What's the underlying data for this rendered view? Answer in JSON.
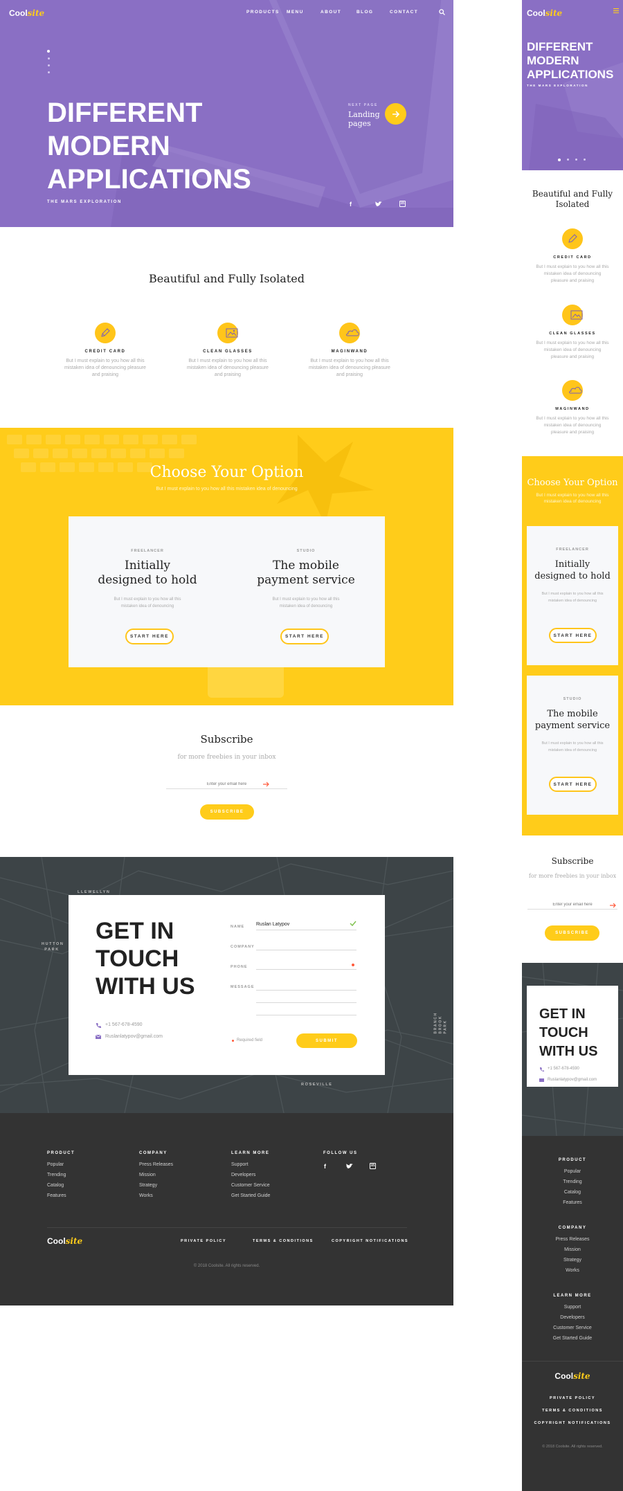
{
  "brand": {
    "cool": "Cool",
    "site": "site"
  },
  "nav": {
    "items": [
      "PRODUCTS",
      "MENU",
      "ABOUT",
      "BLOG",
      "CONTACT"
    ]
  },
  "hero": {
    "title_lines": [
      "DIFFERENT",
      "MODERN",
      "APPLICATIONS"
    ],
    "subtitle": "THE MARS EXPLORATION",
    "next_label": "NEXT PAGE",
    "next_title_lines": [
      "Landing",
      "pages"
    ]
  },
  "features": {
    "heading": "Beautiful and Fully Isolated",
    "items": [
      {
        "icon": "pencil-icon",
        "title": "CREDIT CARD",
        "text": "But I must explain to you how all this mistaken idea of denouncing pleasure and praising"
      },
      {
        "icon": "image-icon",
        "title": "CLEAN GLASSES",
        "text": "But I must explain to you how all this mistaken idea of denouncing pleasure and praising"
      },
      {
        "icon": "cloud-icon",
        "title": "MAGINWAND",
        "text": "But I must explain to you how all this mistaken idea of denouncing pleasure and praising"
      }
    ]
  },
  "options": {
    "heading": "Choose Your Option",
    "sub": "But I must explain to you how all this mistaken idea of denouncing",
    "cards": [
      {
        "label": "FREELANCER",
        "title_lines": [
          "Initially",
          "designed to hold"
        ],
        "text_lines": [
          "But I must explain to you how all this",
          "mistaken idea of denouncing"
        ],
        "button": "START HERE"
      },
      {
        "label": "STUDIO",
        "title_lines": [
          "The mobile",
          "payment service"
        ],
        "text_lines": [
          "But I must explain to you how all this",
          "mistaken idea of denouncing"
        ],
        "button": "START HERE"
      }
    ]
  },
  "subscribe": {
    "heading": "Subscribe",
    "sub": "for more freebies in your inbox",
    "placeholder": "Enter your email here",
    "button": "SUBSCRIBE"
  },
  "contact": {
    "title_lines": [
      "GET IN",
      "TOUCH",
      "WITH US"
    ],
    "phone": "+1 567-678-4590",
    "email": "Ruslanlatypov@gmail.com",
    "fields": {
      "name_label": "NAME",
      "name_value": "Ruslan Latypov",
      "company_label": "COMPANY",
      "phone_label": "PHONE",
      "message_label": "MESSAGE"
    },
    "required": "Required field",
    "submit": "SUBMIT",
    "map_labels": [
      "LLEWELLYN",
      "HUTTON PARK",
      "ROSEVILLE",
      "BRANCH BROOK PARK"
    ]
  },
  "footer": {
    "columns": [
      {
        "title": "PRODUCT",
        "links": [
          "Popular",
          "Trending",
          "Catalog",
          "Features"
        ]
      },
      {
        "title": "COMPANY",
        "links": [
          "Press Releases",
          "Mission",
          "Strategy",
          "Works"
        ]
      },
      {
        "title": "LEARN MORE",
        "links": [
          "Support",
          "Developers",
          "Customer Service",
          "Get Started Guide"
        ]
      }
    ],
    "follow": "FOLLOW US",
    "legal": [
      "PRIVATE POLICY",
      "TERMS & CONDITIONS",
      "COPYRIGHT NOTIFICATIONS"
    ],
    "copyright": "© 2018 Coolsite. All rights reserved."
  },
  "colors": {
    "purple": "#8a6fc4",
    "yellow": "#ffcc1a",
    "dark": "#333333",
    "map": "#3d4447"
  }
}
